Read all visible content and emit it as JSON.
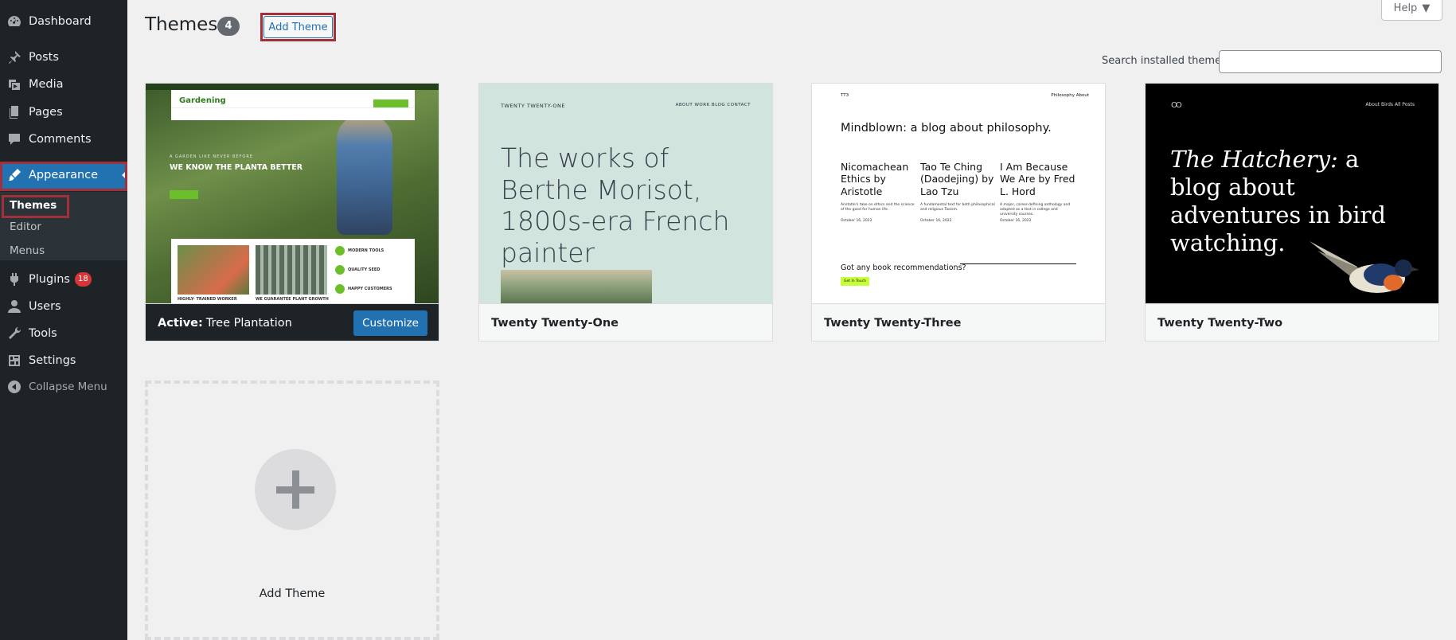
{
  "sidebar": {
    "items": [
      {
        "label": "Dashboard",
        "icon": "dashboard-icon"
      },
      {
        "label": "Posts",
        "icon": "pin-icon"
      },
      {
        "label": "Media",
        "icon": "media-icon"
      },
      {
        "label": "Pages",
        "icon": "pages-icon"
      },
      {
        "label": "Comments",
        "icon": "comment-icon"
      },
      {
        "label": "Appearance",
        "icon": "paintbrush-icon"
      },
      {
        "label": "Plugins",
        "icon": "plugin-icon",
        "badge": "18"
      },
      {
        "label": "Users",
        "icon": "user-icon"
      },
      {
        "label": "Tools",
        "icon": "wrench-icon"
      },
      {
        "label": "Settings",
        "icon": "settings-icon"
      }
    ],
    "submenu": [
      "Themes",
      "Editor",
      "Menus"
    ],
    "collapse_label": "Collapse Menu"
  },
  "header": {
    "title": "Themes",
    "count": "4",
    "add_button": "Add Theme",
    "help_label": "Help",
    "search_label": "Search installed themes",
    "search_value": ""
  },
  "themes": [
    {
      "name": "Tree Plantation",
      "active_prefix": "Active:",
      "customize_label": "Customize",
      "preview": {
        "hero": "WE KNOW THE PLANTA BETTER",
        "tag": "A GARDEN LIKE NEVER BEFORE",
        "logo": "Gardening",
        "features": [
          "MODERN TOOLS",
          "QUALITY SEED",
          "HAPPY CUSTOMERS"
        ],
        "captions": [
          "HIGHLY- TRAINED WORKER",
          "WE GUARANTEE PLANT GROWTH"
        ]
      }
    },
    {
      "name": "Twenty Twenty-One",
      "preview": {
        "site": "TWENTY TWENTY-ONE",
        "nav": "ABOUT   WORK   BLOG   CONTACT",
        "hero": "The works of Berthe Morisot, 1800s-era French painter"
      }
    },
    {
      "name": "Twenty Twenty-Three",
      "preview": {
        "site": "TT3",
        "nav": "Philosophy   About",
        "headline": "Mindblown: a blog about philosophy.",
        "posts": [
          {
            "title": "Nicomachean Ethics by Aristotle",
            "excerpt": "Aristotle's take on ethics and the science of the good for human life.",
            "date": "October 16, 2022"
          },
          {
            "title": "Tao Te Ching (Daodejing) by Lao Tzu",
            "excerpt": "A fundamental text for both philosophical and religious Taoism.",
            "date": "October 16, 2022"
          },
          {
            "title": "I Am Because We Are by Fred L. Hord",
            "excerpt": "A major, career-defining anthology and adopted as a text in college and university courses.",
            "date": "October 16, 2022"
          }
        ],
        "reco": "Got any book recommendations?",
        "button": "Get In Touch"
      }
    },
    {
      "name": "Twenty Twenty-Two",
      "preview": {
        "logo": "OO",
        "nav": "About     Birds     All Posts",
        "hero_em": "The Hatchery:",
        "hero_rest": " a blog about adventures in bird watching."
      }
    }
  ],
  "add_new": {
    "label": "Add Theme"
  },
  "colors": {
    "sidebar_bg": "#1d2327",
    "accent": "#2271b1",
    "highlight_border": "#a2303a",
    "badge": "#d63638"
  }
}
